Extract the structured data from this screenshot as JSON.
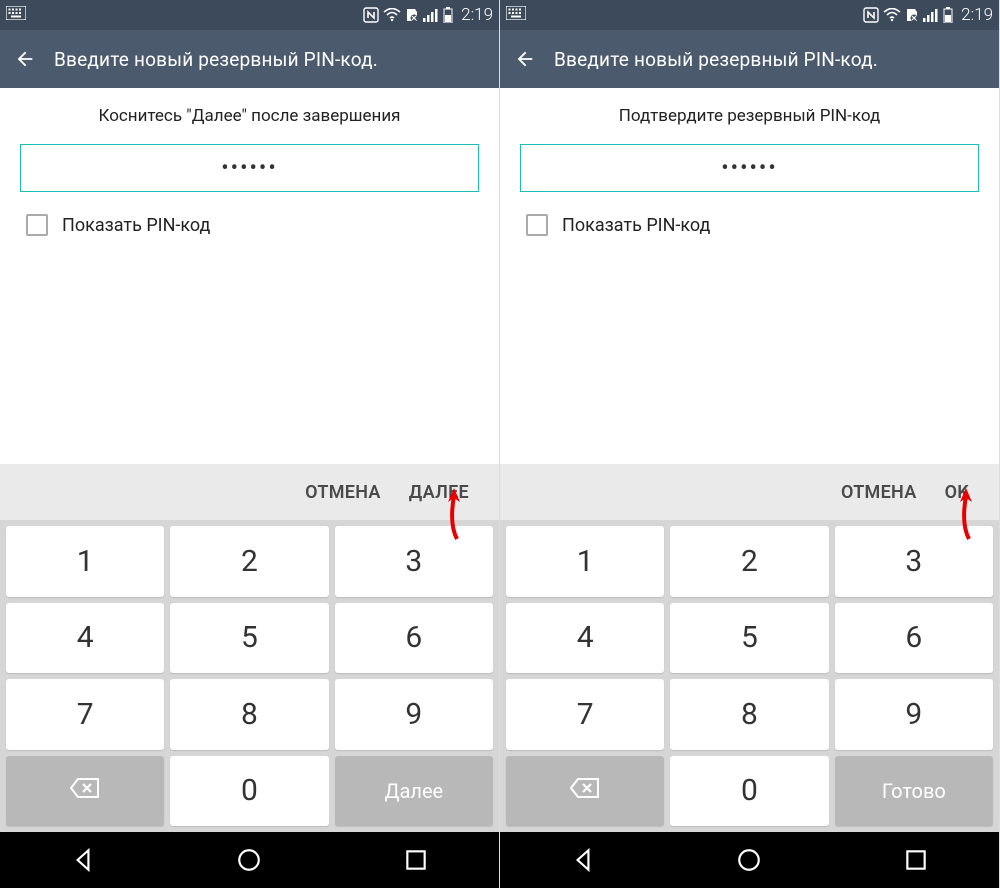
{
  "status": {
    "time": "2:19"
  },
  "screens": [
    {
      "header_title": "Введите новый резервный PIN-код.",
      "instruction": "Коснитесь \"Далее\" после завершения",
      "pin_value": "••••••",
      "show_pin_label": "Показать PIN-код",
      "cancel_label": "ОТМЕНА",
      "confirm_label": "ДАЛЕЕ",
      "done_key_label": "Далее"
    },
    {
      "header_title": "Введите новый резервный PIN-код.",
      "instruction": "Подтвердите резервный PIN-код",
      "pin_value": "••••••",
      "show_pin_label": "Показать PIN-код",
      "cancel_label": "ОТМЕНА",
      "confirm_label": "OK",
      "done_key_label": "Готово"
    }
  ],
  "keypad": {
    "keys": [
      "1",
      "2",
      "3",
      "4",
      "5",
      "6",
      "7",
      "8",
      "9",
      "",
      "0",
      ""
    ]
  }
}
